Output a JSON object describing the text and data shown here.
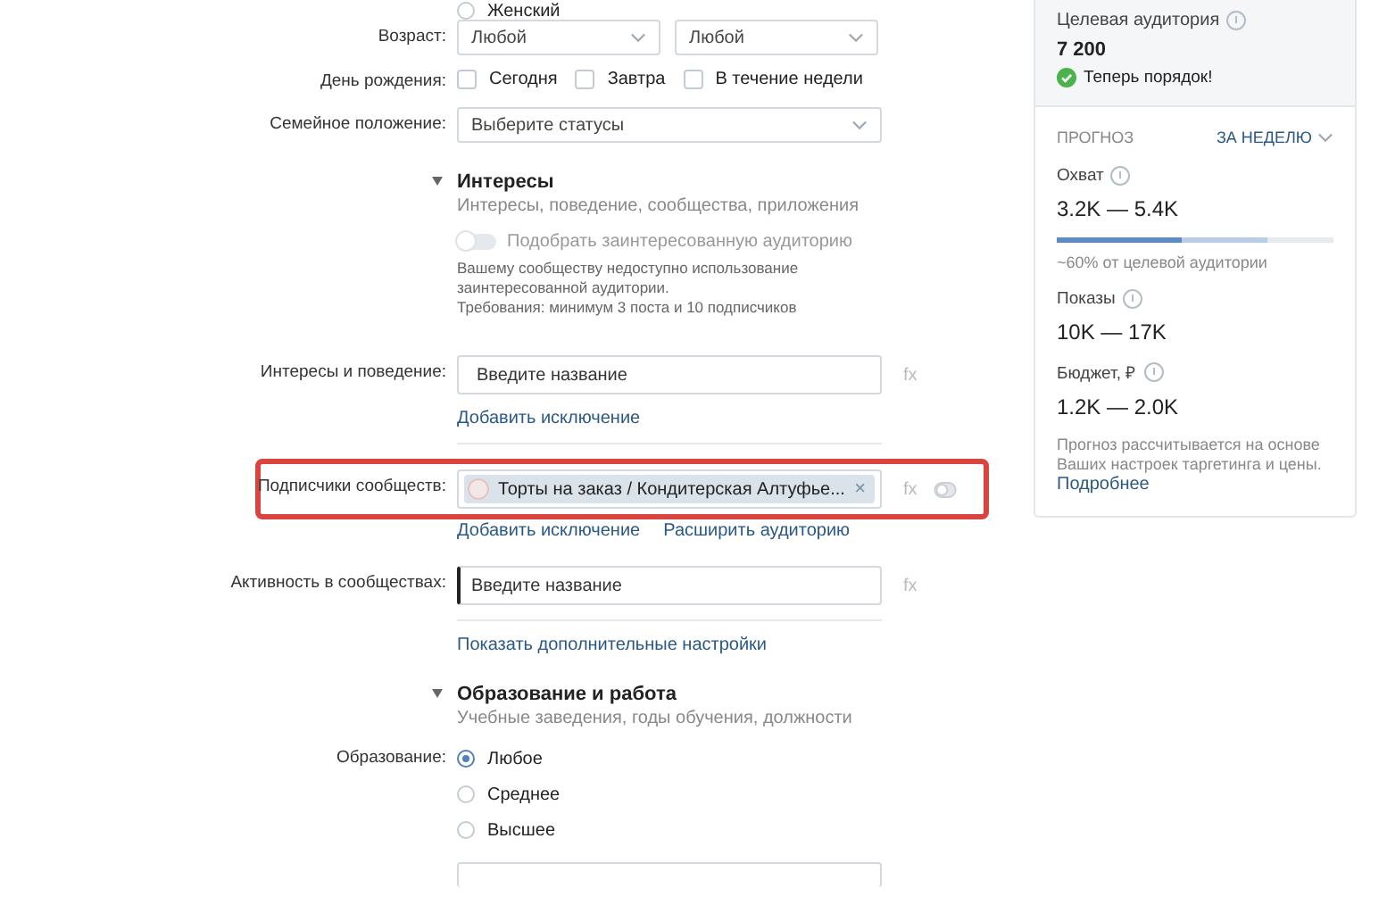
{
  "gender_option": {
    "label": "Женский",
    "selected": false
  },
  "age": {
    "label": "Возраст:",
    "from": "Любой",
    "to": "Любой"
  },
  "birthday": {
    "label": "День рождения:",
    "options": [
      {
        "label": "Сегодня",
        "checked": false
      },
      {
        "label": "Завтра",
        "checked": false
      },
      {
        "label": "В течение недели",
        "checked": false
      }
    ]
  },
  "marital": {
    "label": "Семейное положение:",
    "placeholder": "Выберите статусы"
  },
  "interests_section": {
    "title": "Интересы",
    "expanded": true,
    "subtitle": "Интересы, поведение, сообщества, приложения",
    "toggle": {
      "label": "Подобрать заинтересованную аудиторию",
      "on": false
    },
    "notes": [
      "Вашему сообществу недоступно использование",
      "заинтересованной аудитории.",
      "Требования: минимум 3 поста и 10 подписчиков"
    ]
  },
  "fields": [
    {
      "kind": "input",
      "label": "Интересы и поведение:",
      "placeholder": "Введите название",
      "formula": "fx",
      "links": [
        "Добавить исключение"
      ],
      "highlighted": false
    },
    {
      "kind": "tags",
      "label": "Подписчики сообществ:",
      "tags": [
        "Торты на заказ / Кондитерская Алтуфье..."
      ],
      "remove": "×",
      "formula": "fx",
      "links": [
        "Добавить исключение",
        "Расширить аудиторию"
      ],
      "highlighted": true
    },
    {
      "kind": "input",
      "label": "Активность в сообществах:",
      "placeholder": "Введите название",
      "formula": "fx",
      "highlighted": false,
      "focused": true
    }
  ],
  "more_settings_link": "Показать дополнительные настройки",
  "education_section": {
    "title": "Образование и работа",
    "expanded": true,
    "subtitle": "Учебные заведения, годы обучения, должности",
    "label": "Образование:",
    "options": [
      {
        "label": "Любое",
        "selected": true
      },
      {
        "label": "Среднее",
        "selected": false
      },
      {
        "label": "Высшее",
        "selected": false
      }
    ]
  },
  "sidebar": {
    "audience_label": "Целевая аудитория",
    "audience_value": "7 200",
    "status": "Теперь порядок!",
    "forecast_label": "ПРОГНОЗ",
    "period": "ЗА НЕДЕЛЮ",
    "metrics": [
      {
        "label": "Охват",
        "value": "3.2K — 5.4K",
        "bar": [
          {
            "level": 0.45
          },
          {
            "level": 0.76
          }
        ],
        "note": "~60% от целевой аудитории"
      },
      {
        "label": "Показы",
        "value": "10K — 17K"
      },
      {
        "label": "Бюджет, ₽",
        "value": "1.2K — 2.0K"
      }
    ],
    "footer": "Прогноз рассчитывается на основе Ваших настроек таргетинга и цены.",
    "footer_link": "Подробнее"
  }
}
